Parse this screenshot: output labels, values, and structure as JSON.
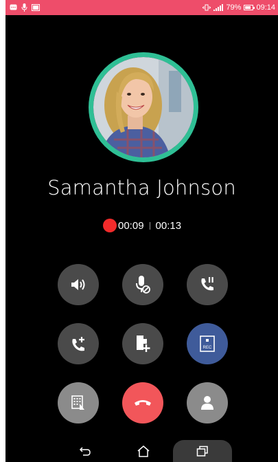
{
  "status_bar": {
    "battery_percent": "79%",
    "battery_level": 0.79,
    "time": "09:14",
    "left_icons": [
      "chat-icon",
      "mic-icon",
      "image-icon"
    ],
    "right_icons": [
      "vibrate-icon",
      "signal-icon",
      "battery-icon"
    ],
    "color": "#ee4d6a"
  },
  "call": {
    "contact_name": "Samantha Johnson",
    "recording_time": "00:09",
    "call_time": "00:13",
    "avatar_ring_color": "#2fbf95",
    "record_dot_color": "#f22b2b"
  },
  "controls": [
    {
      "name": "speaker-button",
      "icon": "speaker-icon"
    },
    {
      "name": "mute-button",
      "icon": "mute-mic-icon"
    },
    {
      "name": "hold-button",
      "icon": "call-hold-icon"
    },
    {
      "name": "add-call-button",
      "icon": "add-call-icon"
    },
    {
      "name": "add-note-button",
      "icon": "add-note-icon"
    },
    {
      "name": "record-button",
      "icon": "record-icon",
      "label": "REC",
      "color": "#3f5b9a"
    },
    {
      "name": "keypad-button",
      "icon": "dialpad-icon",
      "color": "#8b8b8b"
    },
    {
      "name": "end-call-button",
      "icon": "end-call-icon",
      "color": "#f2565a"
    },
    {
      "name": "contact-button",
      "icon": "person-icon",
      "color": "#8b8b8b"
    }
  ],
  "nav_bar": {
    "buttons": [
      "back-icon",
      "home-icon",
      "recents-icon"
    ]
  }
}
